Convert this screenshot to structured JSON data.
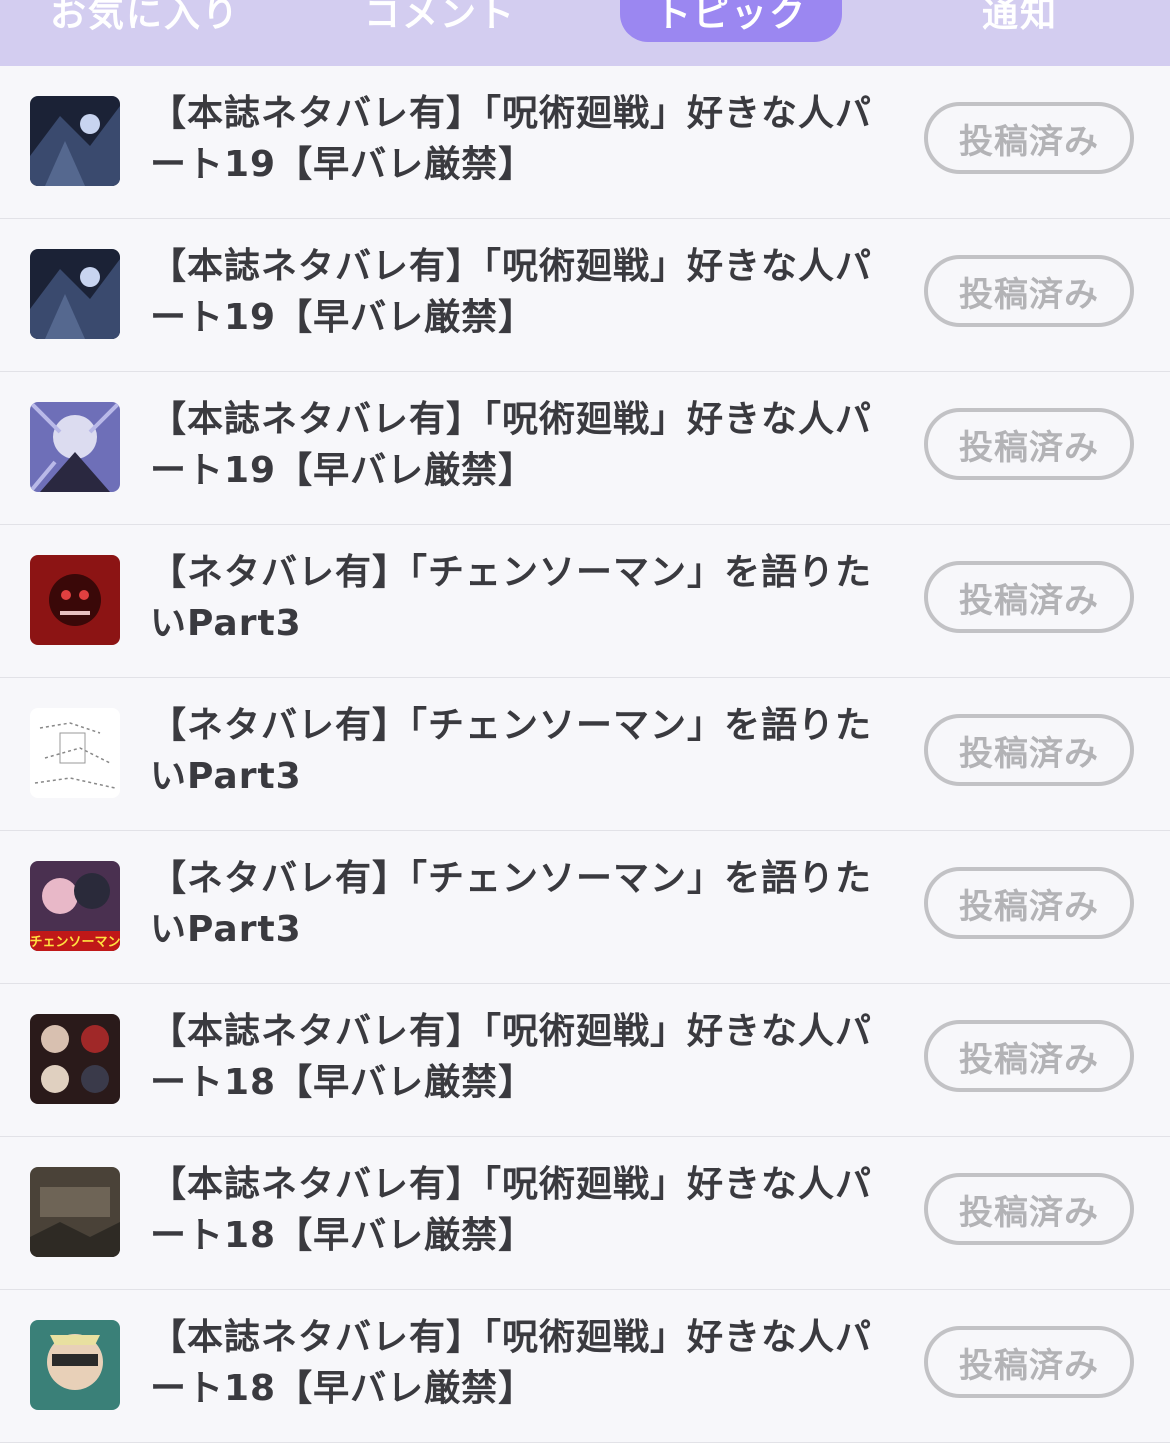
{
  "tabs": [
    {
      "label": "お気に入り"
    },
    {
      "label": "コメント"
    },
    {
      "label": "トピック"
    },
    {
      "label": "通知"
    }
  ],
  "items": [
    {
      "title": "【本誌ネタバレ有】「呪術廻戦」好きな人パート19【早バレ厳禁】",
      "button": "投稿済み"
    },
    {
      "title": "【本誌ネタバレ有】「呪術廻戦」好きな人パート19【早バレ厳禁】",
      "button": "投稿済み"
    },
    {
      "title": "【本誌ネタバレ有】「呪術廻戦」好きな人パート19【早バレ厳禁】",
      "button": "投稿済み"
    },
    {
      "title": "【ネタバレ有】「チェンソーマン」を語りたいPart3",
      "button": "投稿済み"
    },
    {
      "title": "【ネタバレ有】「チェンソーマン」を語りたいPart3",
      "button": "投稿済み"
    },
    {
      "title": "【ネタバレ有】「チェンソーマン」を語りたいPart3",
      "button": "投稿済み",
      "thumb_text": "チェンソーマン"
    },
    {
      "title": "【本誌ネタバレ有】「呪術廻戦」好きな人パート18【早バレ厳禁】",
      "button": "投稿済み"
    },
    {
      "title": "【本誌ネタバレ有】「呪術廻戦」好きな人パート18【早バレ厳禁】",
      "button": "投稿済み"
    },
    {
      "title": "【本誌ネタバレ有】「呪術廻戦」好きな人パート18【早バレ厳禁】",
      "button": "投稿済み"
    }
  ],
  "colors": {
    "accent": "#9b87f1",
    "tabbar": "#d3cdf0"
  }
}
